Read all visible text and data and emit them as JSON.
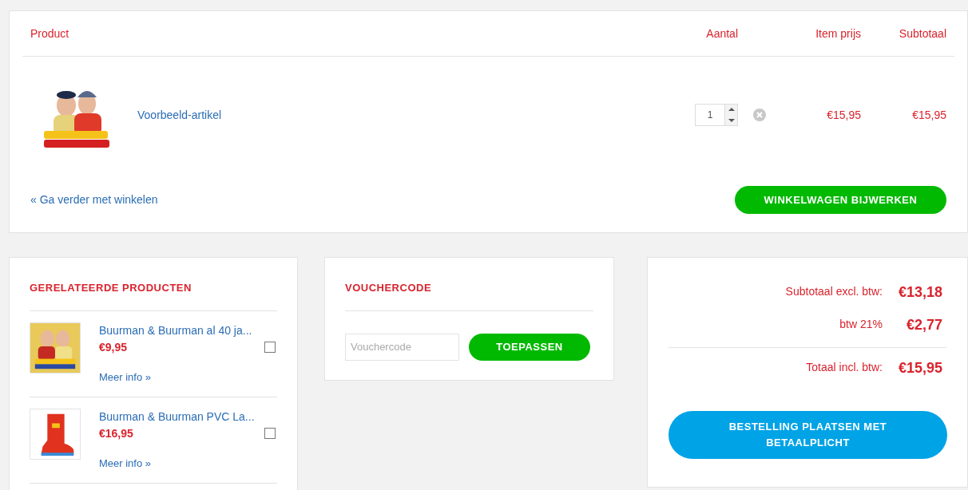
{
  "cart": {
    "columns": [
      "Product",
      "Aantal",
      "Item prijs",
      "Subtotaal"
    ],
    "rows": [
      {
        "kind": "picture",
        "name": "Voorbeeld-artikel",
        "quantity": "1",
        "item_price": "€15,95",
        "subtotal": "€15,95"
      }
    ],
    "continue_link": "« Ga verder met winkelen",
    "update_button": "WINKELWAGEN BIJWERKEN"
  },
  "related": {
    "title": "GERELATEERDE PRODUCTEN",
    "items": [
      {
        "kind": "poster",
        "name": "Buurman & Buurman al 40 ja...",
        "price": "€9,95",
        "checked": false,
        "link": "Meer info »"
      },
      {
        "kind": "boot",
        "name": "Buurman & Buurman PVC La...",
        "price": "€16,95",
        "checked": false,
        "link": "Meer info »"
      }
    ]
  },
  "voucher": {
    "title": "VOUCHERCODE",
    "placeholder": "Vouchercode",
    "button": "TOEPASSEN"
  },
  "totals": {
    "lines": [
      {
        "label": "Subtotaal excl. btw:",
        "value": "€13,18"
      },
      {
        "label": "btw 21%",
        "value": "€2,77"
      }
    ],
    "total": {
      "label": "Totaal incl. btw:",
      "value": "€15,95"
    },
    "order_button": "BESTELLING PLAATSEN MET BETAALPLICHT"
  }
}
